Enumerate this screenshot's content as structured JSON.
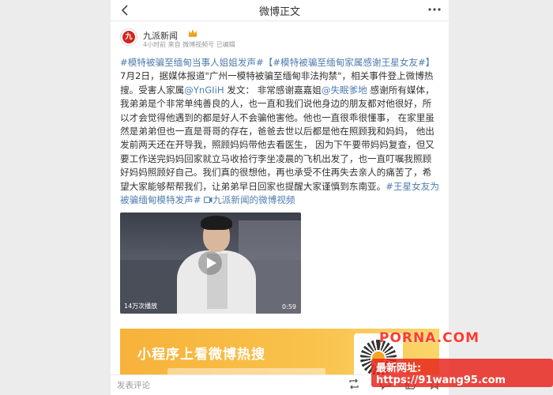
{
  "header": {
    "back_icon": "chevron-left-icon",
    "title": "微博正文",
    "more_icon": "more-dots-icon"
  },
  "author": {
    "name": "九派新闻",
    "logo_text": "九",
    "crown_icon": "crown-icon",
    "meta": "4小时前  来自 微博视频号  已编辑"
  },
  "post": {
    "tag1": "#模特被骗至缅甸当事人姐姐发声#",
    "tag2": "【#模特被骗至缅甸家属感谢王星女友#】",
    "text1": "7月2日，据媒体报道\"广州一模特被骗至缅甸非法拘禁\"，相关事件登上微博热搜。受害人家属",
    "mention1": "@YnGIiH",
    "text2": " 发文：  非常感谢嘉嘉姐",
    "mention2": "@失眠爹地",
    "text3": " 感谢所有媒体，我弟弟是个非常单纯善良的人，也一直和我们说他身边的朋友都对他很好，所以才会觉得他遇到的都是好人不会骗他害他。他也一直很乖很懂事，  在家里虽然是弟弟但也一直是哥哥的存在，爸爸去世以后都是他在照顾我和妈妈，  他出发前两天还在开导我，照顾妈妈带他去看医生，  因为下午要带妈妈复查，但又要工作送完妈妈回家就立马收拾行李坐凌晨的飞机出发了，也一直叮嘱我照顾好妈妈照顾好自己。我们真的很想他，再也承受不住再失去亲人的痛苦了，希望大家能够帮帮我们，让弟弟早日回家也提醒大家谨慎到东南亚。",
    "tag3": "#王星女友为被骗缅甸模特发声#",
    "link_icon": "video-link-icon",
    "link_text": "九派新闻的微博视频"
  },
  "video": {
    "play_icon": "play-icon",
    "play_count": "14万次播放",
    "duration": "0:59"
  },
  "ad": {
    "text": "小程序上看微博热搜"
  },
  "comment_bar": {
    "placeholder": "发表评论",
    "repost_icon": "repost-icon",
    "comment_icon": "comment-icon",
    "like_icon": "like-icon",
    "favorite_icon": "favorite-icon"
  },
  "watermark": {
    "site": "PORNA.COM",
    "url": "最新网址: https://91wang95.com"
  }
}
